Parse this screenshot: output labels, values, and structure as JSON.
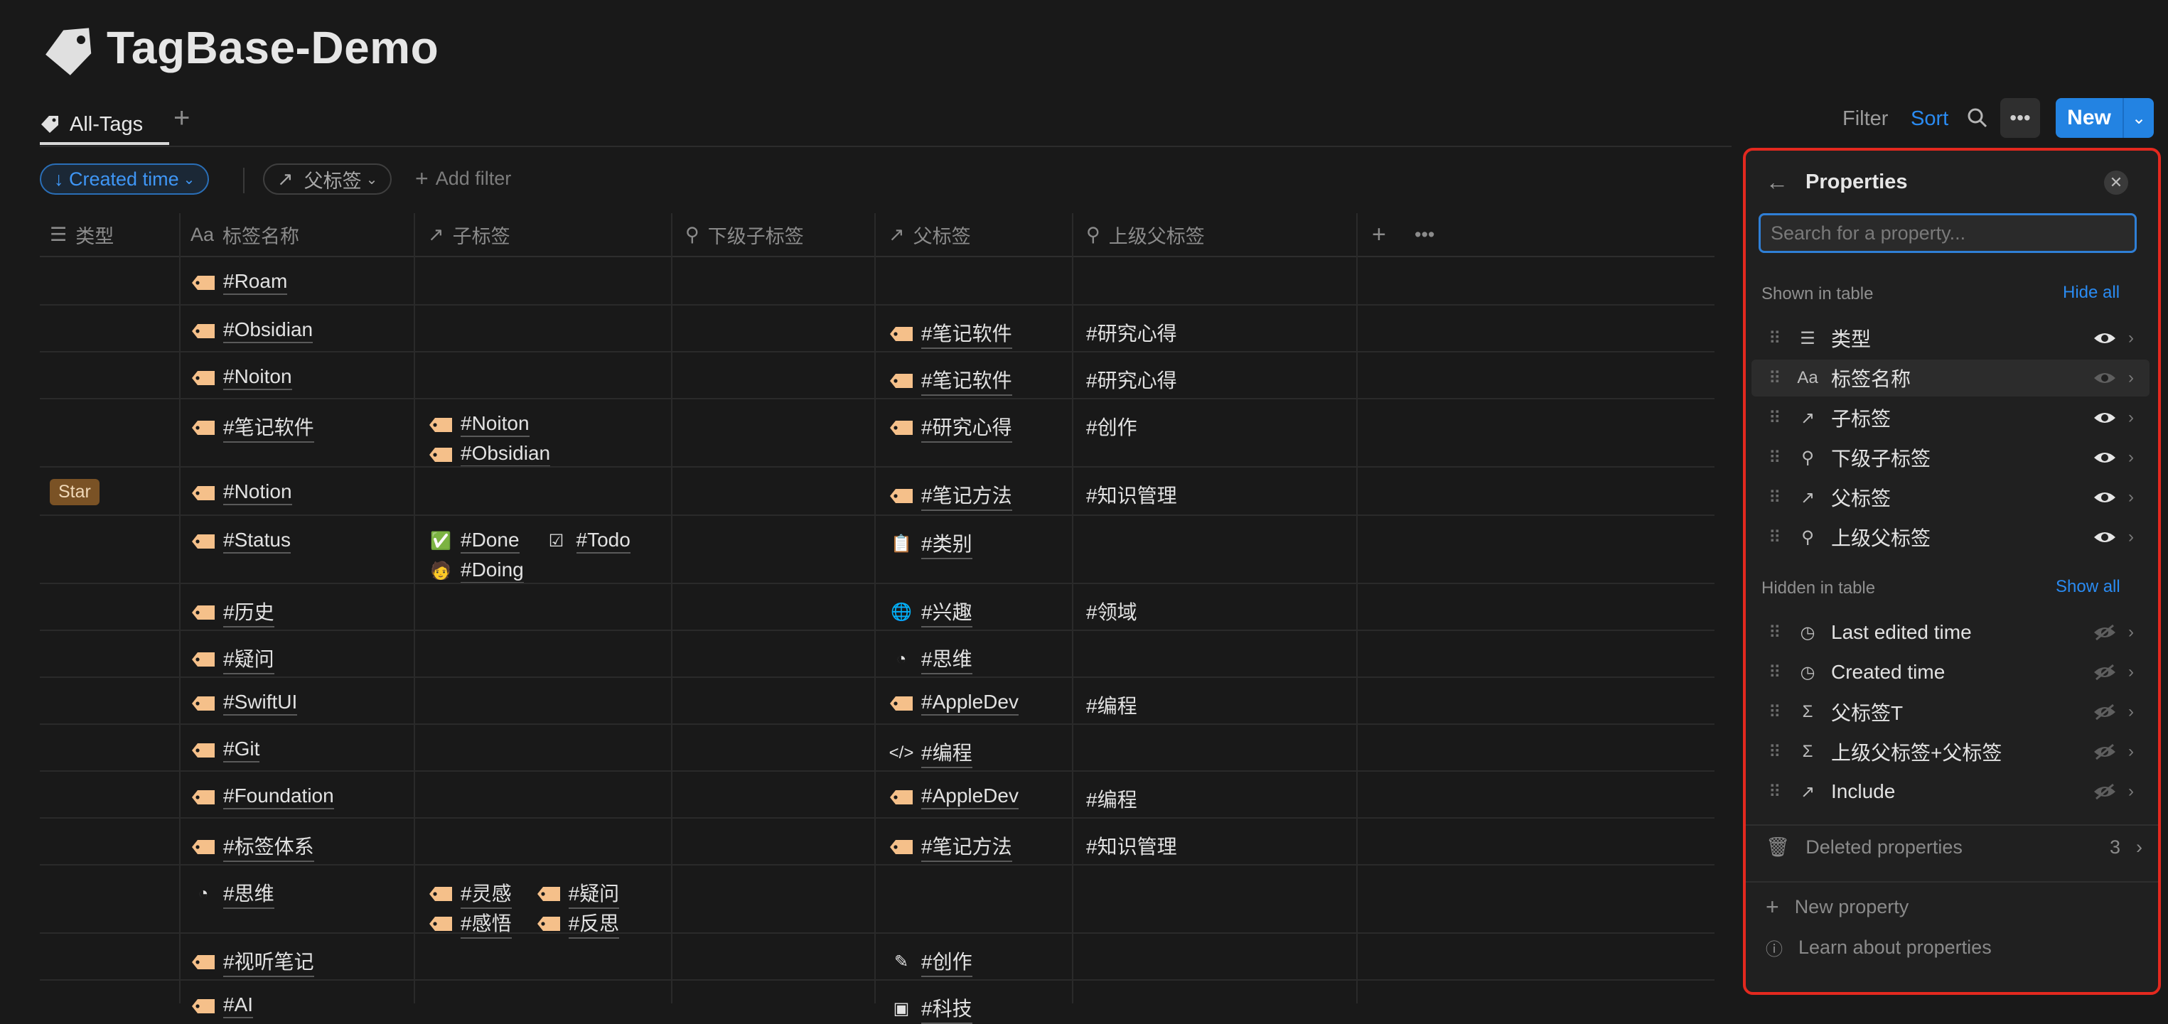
{
  "page": {
    "title": "TagBase-Demo"
  },
  "tabs": [
    {
      "label": "All-Tags"
    }
  ],
  "toolbar": {
    "filter": "Filter",
    "sort": "Sort",
    "new": "New"
  },
  "filters": {
    "sort_chip": "Created time",
    "parent_chip": "父标签",
    "add_filter": "Add filter"
  },
  "columns": {
    "type": "类型",
    "name": "标签名称",
    "child": "子标签",
    "sub_child": "下级子标签",
    "parent": "父标签",
    "upper_parent": "上级父标签"
  },
  "rows": [
    {
      "name": "#Roam"
    },
    {
      "name": "#Obsidian",
      "parent": "#笔记软件",
      "upper": "#研究心得"
    },
    {
      "name": "#Noiton",
      "parent": "#笔记软件",
      "upper": "#研究心得"
    },
    {
      "name": "#笔记软件",
      "child1": "#Noiton",
      "child2": "#Obsidian",
      "parent": "#研究心得",
      "upper": "#创作"
    },
    {
      "type": "Star",
      "name": "#Notion",
      "parent": "#笔记方法",
      "upper": "#知识管理"
    },
    {
      "name": "#Status",
      "child1": "#Done",
      "child1b": "#Todo",
      "child2": "#Doing",
      "parent": "#类别"
    },
    {
      "name": "#历史",
      "parent": "#兴趣",
      "upper": "#领域"
    },
    {
      "name": "#疑问",
      "parent": "#思维"
    },
    {
      "name": "#SwiftUI",
      "parent": "#AppleDev",
      "upper": "#编程"
    },
    {
      "name": "#Git",
      "parent": "#编程"
    },
    {
      "name": "#Foundation",
      "parent": "#AppleDev",
      "upper": "#编程"
    },
    {
      "name": "#标签体系",
      "parent": "#笔记方法",
      "upper": "#知识管理"
    },
    {
      "name": "#思维",
      "child1": "#灵感",
      "child1b": "#疑问",
      "child2": "#感悟",
      "child2b": "#反思"
    },
    {
      "name": "#视听笔记",
      "parent": "#创作"
    },
    {
      "name": "#AI",
      "parent": "#科技"
    }
  ],
  "panel": {
    "title": "Properties",
    "search_placeholder": "Search for a property...",
    "shown_label": "Shown in table",
    "hide_all": "Hide all",
    "hidden_label": "Hidden in table",
    "show_all": "Show all",
    "shown": [
      {
        "name": "类型",
        "icon": "list-icon"
      },
      {
        "name": "标签名称",
        "icon": "text-icon"
      },
      {
        "name": "子标签",
        "icon": "relation-arrow-icon"
      },
      {
        "name": "下级子标签",
        "icon": "search-icon"
      },
      {
        "name": "父标签",
        "icon": "relation-arrow-icon"
      },
      {
        "name": "上级父标签",
        "icon": "search-icon"
      }
    ],
    "hidden": [
      {
        "name": "Last edited time",
        "icon": "clock-icon"
      },
      {
        "name": "Created time",
        "icon": "clock-icon"
      },
      {
        "name": "父标签T",
        "icon": "sigma-icon"
      },
      {
        "name": "上级父标签+父标签",
        "icon": "sigma-icon"
      },
      {
        "name": "Include",
        "icon": "relation-arrow-icon"
      }
    ],
    "deleted_label": "Deleted properties",
    "deleted_count": "3",
    "new_property": "New property",
    "learn": "Learn about properties"
  },
  "colors": {
    "accent": "#2383e2",
    "panel_border": "#e3291f",
    "tag_icon": "#f5c08a",
    "star_badge": "#7a5225"
  }
}
